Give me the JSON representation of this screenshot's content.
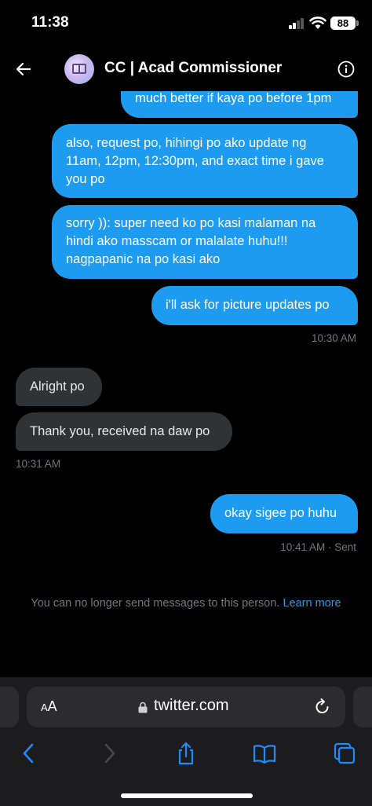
{
  "status_bar": {
    "time": "11:38",
    "battery": "88"
  },
  "header": {
    "title": "CC | Acad Commissioner"
  },
  "messages": [
    {
      "text": "much better if kaya po before 1pm"
    },
    {
      "text": "also, request po, hihingi po ako update ng 11am, 12pm, 12:30pm, and exact time i gave you po"
    },
    {
      "text": "sorry )): super need ko po kasi malaman na hindi ako masscam or malalate huhu!!! nagpapanic na po kasi ako"
    },
    {
      "text": "i'll ask for picture updates po"
    },
    {
      "time": "10:30 AM"
    },
    {
      "text": "Alright po"
    },
    {
      "text": "Thank you, received na daw po"
    },
    {
      "time": "10:31 AM"
    },
    {
      "text": "okay sigee po huhu"
    },
    {
      "time": "10:41 AM · Sent"
    }
  ],
  "notice": {
    "text": "You can no longer send messages to this person.",
    "link": "Learn more"
  },
  "browser": {
    "aa_small": "A",
    "aa_large": "A",
    "url": "twitter.com"
  },
  "colors": {
    "accent": "#1d9bf0",
    "incoming_bubble": "#2f3336",
    "muted_text": "#71767b"
  },
  "icons": [
    "back-arrow-icon",
    "avatar-book-icon",
    "info-icon",
    "lock-icon",
    "reload-icon",
    "chevron-left-icon",
    "chevron-right-icon",
    "share-icon",
    "bookmarks-icon",
    "tabs-icon"
  ]
}
